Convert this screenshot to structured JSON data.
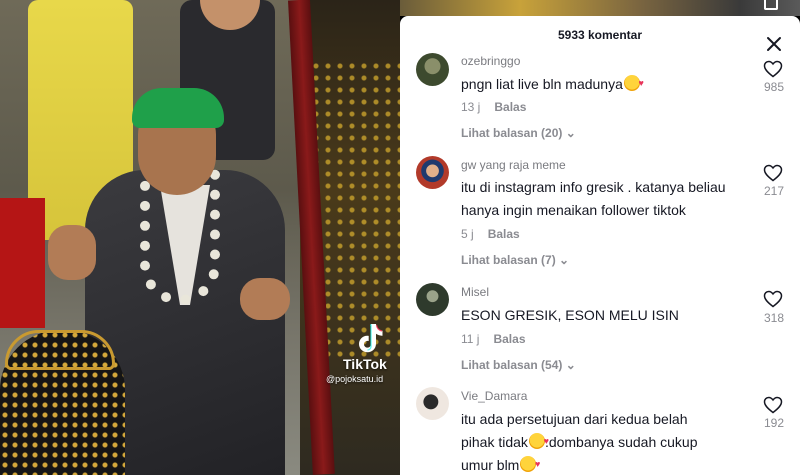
{
  "video": {
    "brand": "TikTok",
    "username": "@pojoksatu.id"
  },
  "panel": {
    "title": "5933 komentar",
    "close_icon": "close-icon"
  },
  "comments": [
    {
      "username": "ozebringgo",
      "text": "pngn liat live bln madunya",
      "emoji": "smiling-face-with-hearts",
      "time": "13 j",
      "reply_label": "Balas",
      "view_replies": "Lihat balasan (20)",
      "likes": "985",
      "avatar_color": "#3d4a2e"
    },
    {
      "username": "gw yang raja meme",
      "text": "itu di instagram info gresik . katanya beliau hanya ingin menaikan follower tiktok",
      "emoji": "",
      "time": "5 j",
      "reply_label": "Balas",
      "view_replies": "Lihat balasan (7)",
      "likes": "217",
      "avatar_color": "#b23a2a"
    },
    {
      "username": "Misel",
      "text": "ESON GRESIK, ESON MELU ISIN",
      "emoji": "",
      "time": "11 j",
      "reply_label": "Balas",
      "view_replies": "Lihat balasan (54)",
      "likes": "318",
      "avatar_color": "#2e3a2c"
    },
    {
      "username": "Vie_Damara",
      "text_line1": "itu ada persetujuan dari kedua belah",
      "text_line2": "pihak tidak",
      "text_line2_after": ".dombanya sudah cukup",
      "text_line3": "umur blm",
      "emoji": "smiling-face-with-hearts",
      "likes": "192",
      "avatar_color": "#d9cfc8"
    }
  ]
}
